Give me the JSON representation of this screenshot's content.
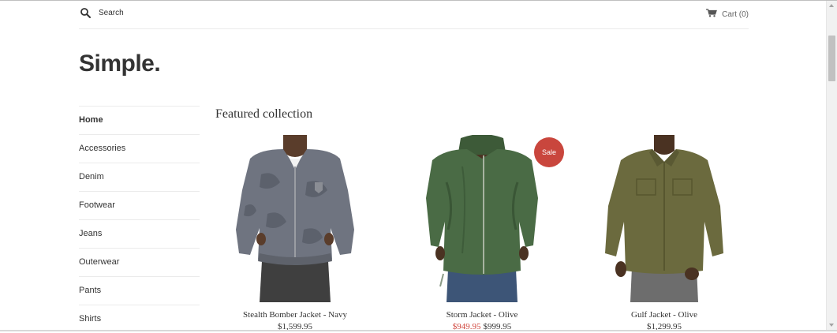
{
  "header": {
    "search_placeholder": "Search",
    "cart_label": "Cart (0)"
  },
  "logo": "Simple.",
  "nav": {
    "items": [
      {
        "label": "Home",
        "active": true
      },
      {
        "label": "Accessories"
      },
      {
        "label": "Denim"
      },
      {
        "label": "Footwear"
      },
      {
        "label": "Jeans"
      },
      {
        "label": "Outerwear"
      },
      {
        "label": "Pants"
      },
      {
        "label": "Shirts"
      }
    ]
  },
  "main": {
    "title": "Featured collection",
    "products": [
      {
        "name": "Stealth Bomber Jacket - Navy",
        "price": "$1,599.95"
      },
      {
        "name": "Storm Jacket - Olive",
        "sale_price": "$949.95",
        "compare_price": "$999.95",
        "badge": "Sale"
      },
      {
        "name": "Gulf Jacket - Olive",
        "price": "$1,299.95"
      }
    ]
  },
  "icons": {
    "search": "search-icon",
    "cart": "cart-icon"
  },
  "colors": {
    "sale_badge": "#c9463d",
    "sale_price": "#d0463d",
    "text": "#333333"
  }
}
